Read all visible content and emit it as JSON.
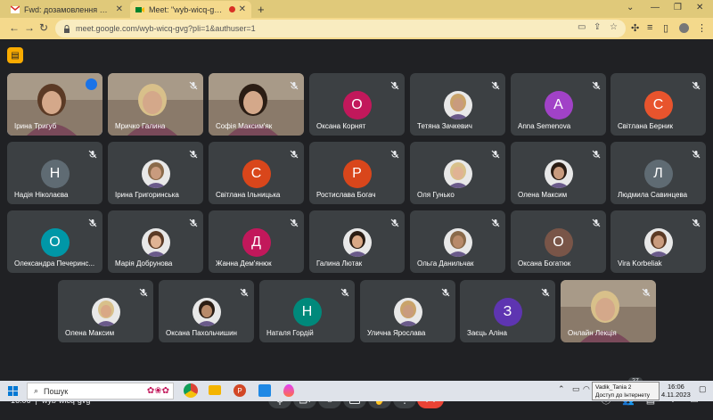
{
  "browser": {
    "tabs": [
      {
        "title": "Fwd: дозамовлення Великі Бр..."
      },
      {
        "title": "Meet: \"wyb-wicq-gvg\""
      }
    ],
    "url": "meet.google.com/wyb-wicq-gvg?pli=1&authuser=1"
  },
  "participants": [
    {
      "name": "Ірина Тригуб",
      "kind": "video",
      "speaking": true
    },
    {
      "name": "Мричко Галина",
      "kind": "video"
    },
    {
      "name": "Софія Максим'як",
      "kind": "video"
    },
    {
      "name": "Оксана Корнят",
      "kind": "letter",
      "letter": "О",
      "color": "#c2185b"
    },
    {
      "name": "Тетяна Зачкевич",
      "kind": "photo"
    },
    {
      "name": "Anna Semenova",
      "kind": "letter",
      "letter": "А",
      "color": "#a142c7"
    },
    {
      "name": "Світлана Берник",
      "kind": "letter",
      "letter": "С",
      "color": "#e8542d"
    },
    {
      "name": "Надія Ніколаєва",
      "kind": "letter",
      "letter": "Н",
      "color": "#5f6b73"
    },
    {
      "name": "Ірина Григоринська",
      "kind": "photo"
    },
    {
      "name": "Світлана Ільницька",
      "kind": "letter",
      "letter": "С",
      "color": "#d9461b"
    },
    {
      "name": "Ростислава Богач",
      "kind": "letter",
      "letter": "Р",
      "color": "#d9461b"
    },
    {
      "name": "Оля Гунько",
      "kind": "photo"
    },
    {
      "name": "Олена Максим",
      "kind": "photo"
    },
    {
      "name": "Людмила Савинцева",
      "kind": "letter",
      "letter": "Л",
      "color": "#5f6b73"
    },
    {
      "name": "Олександра Печеринс...",
      "kind": "letter",
      "letter": "О",
      "color": "#0097a7"
    },
    {
      "name": "Марія Добрунова",
      "kind": "photo"
    },
    {
      "name": "Жанна Дем'янюк",
      "kind": "letter",
      "letter": "Д",
      "color": "#c2185b"
    },
    {
      "name": "Галина Лютак",
      "kind": "photo"
    },
    {
      "name": "Ольга Данильчак",
      "kind": "photo"
    },
    {
      "name": "Оксана Богатюк",
      "kind": "letter",
      "letter": "О",
      "color": "#795548"
    },
    {
      "name": "Vira Korbeliak",
      "kind": "photo"
    },
    {
      "name": "Олена Максим",
      "kind": "photo"
    },
    {
      "name": "Оксана Пахольчишин",
      "kind": "photo"
    },
    {
      "name": "Наталя Гордій",
      "kind": "letter",
      "letter": "Н",
      "color": "#00897b"
    },
    {
      "name": "Уличнa Ярослава",
      "kind": "photo"
    },
    {
      "name": "Заєць Аліна",
      "kind": "letter",
      "letter": "З",
      "color": "#5e35b1"
    },
    {
      "name": "Онлайн Лекція",
      "kind": "video"
    }
  ],
  "bottom_bar": {
    "time": "16:06",
    "meeting_code": "wyb-wicq-gvg",
    "participant_count": "27"
  },
  "taskbar": {
    "search_placeholder": "Пошук",
    "tooltip_line1": "Vadik_Tania 2",
    "tooltip_line2": "Доступ до Інтернету",
    "clock_time": "16:06",
    "clock_date": "4.11.2023"
  }
}
